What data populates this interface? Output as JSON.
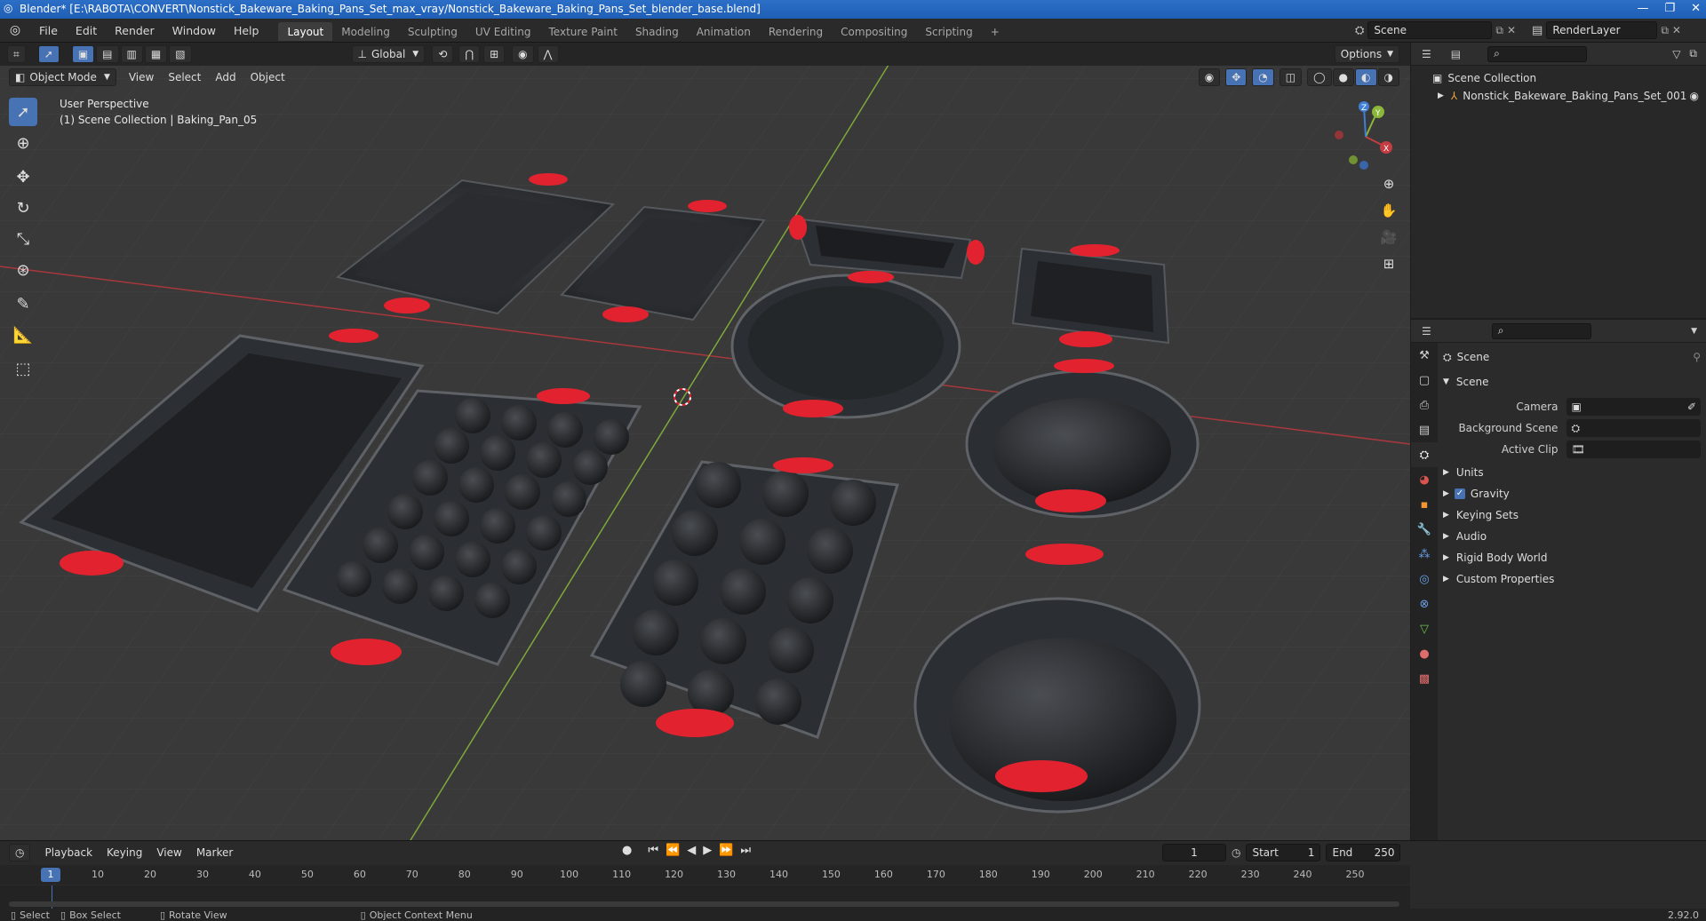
{
  "window": {
    "title": "Blender* [E:\\RABOTA\\CONVERT\\Nonstick_Bakeware_Baking_Pans_Set_max_vray/Nonstick_Bakeware_Baking_Pans_Set_blender_base.blend]"
  },
  "menu": {
    "items": [
      "File",
      "Edit",
      "Render",
      "Window",
      "Help"
    ],
    "workspaces": [
      "Layout",
      "Modeling",
      "Sculpting",
      "UV Editing",
      "Texture Paint",
      "Shading",
      "Animation",
      "Rendering",
      "Compositing",
      "Scripting"
    ],
    "active_workspace": "Layout",
    "add_tab": "+",
    "scene": "Scene",
    "view_layer": "RenderLayer"
  },
  "viewport": {
    "mode": "Object Mode",
    "menus": [
      "View",
      "Select",
      "Add",
      "Object"
    ],
    "transform_orientation": "Global",
    "options_label": "Options",
    "info_line1": "User Perspective",
    "info_line2": "(1) Scene Collection | Baking_Pan_05",
    "gizmo_axes": {
      "x": "X",
      "y": "Y",
      "z": "Z"
    }
  },
  "outliner": {
    "root": "Scene Collection",
    "items": [
      "Nonstick_Bakeware_Baking_Pans_Set_001"
    ]
  },
  "properties": {
    "context": "Scene",
    "panel": "Scene",
    "fields": [
      {
        "label": "Camera",
        "value": ""
      },
      {
        "label": "Background Scene",
        "value": ""
      },
      {
        "label": "Active Clip",
        "value": ""
      }
    ],
    "sections": [
      {
        "label": "Units",
        "checkbox": false
      },
      {
        "label": "Gravity",
        "checkbox": true
      },
      {
        "label": "Keying Sets",
        "checkbox": false
      },
      {
        "label": "Audio",
        "checkbox": false
      },
      {
        "label": "Rigid Body World",
        "checkbox": false
      },
      {
        "label": "Custom Properties",
        "checkbox": false
      }
    ]
  },
  "timeline": {
    "menus": [
      "Playback",
      "Keying",
      "View",
      "Marker"
    ],
    "current_frame": "1",
    "start_label": "Start",
    "start": "1",
    "end_label": "End",
    "end": "250",
    "ticks": [
      "1",
      "10",
      "20",
      "30",
      "40",
      "50",
      "60",
      "70",
      "80",
      "90",
      "100",
      "110",
      "120",
      "130",
      "140",
      "150",
      "160",
      "170",
      "180",
      "190",
      "200",
      "210",
      "220",
      "230",
      "240",
      "250"
    ]
  },
  "status": {
    "select": "Select",
    "box_select": "Box Select",
    "rotate_view": "Rotate View",
    "context_menu": "Object Context Menu",
    "version": "2.92.0"
  },
  "colors": {
    "accent": "#4772b3",
    "handle_red": "#e2232f",
    "pan_body": "#2e3136",
    "x_axis": "#c43d42",
    "y_axis": "#8bb73a",
    "z_axis": "#3f7fd6"
  }
}
